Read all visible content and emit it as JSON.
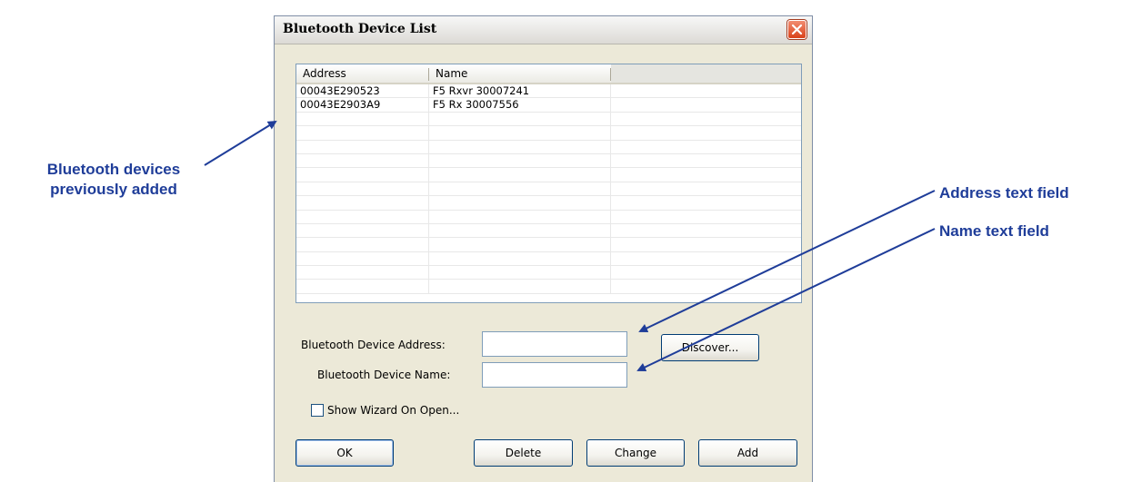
{
  "window": {
    "title": "Bluetooth Device List",
    "close_icon": "close-icon"
  },
  "device_list": {
    "columns": [
      "Address",
      "Name",
      ""
    ],
    "rows": [
      {
        "address": "00043E290523",
        "name": "F5 Rxvr 30007241"
      },
      {
        "address": "00043E2903A9",
        "name": "F5 Rx 30007556"
      }
    ]
  },
  "form": {
    "address_label": "Bluetooth Device Address:",
    "address_value": "",
    "name_label": "Bluetooth Device Name:",
    "name_value": "",
    "discover_label": "Discover...",
    "show_wizard_label": "Show Wizard On Open...",
    "show_wizard_checked": false
  },
  "buttons": {
    "ok": "OK",
    "delete": "Delete",
    "change": "Change",
    "add": "Add"
  },
  "annotations": {
    "devices_line1": "Bluetooth devices",
    "devices_line2": "previously added",
    "address_field": "Address text field",
    "name_field": "Name text field",
    "color": "#1f3d99"
  }
}
